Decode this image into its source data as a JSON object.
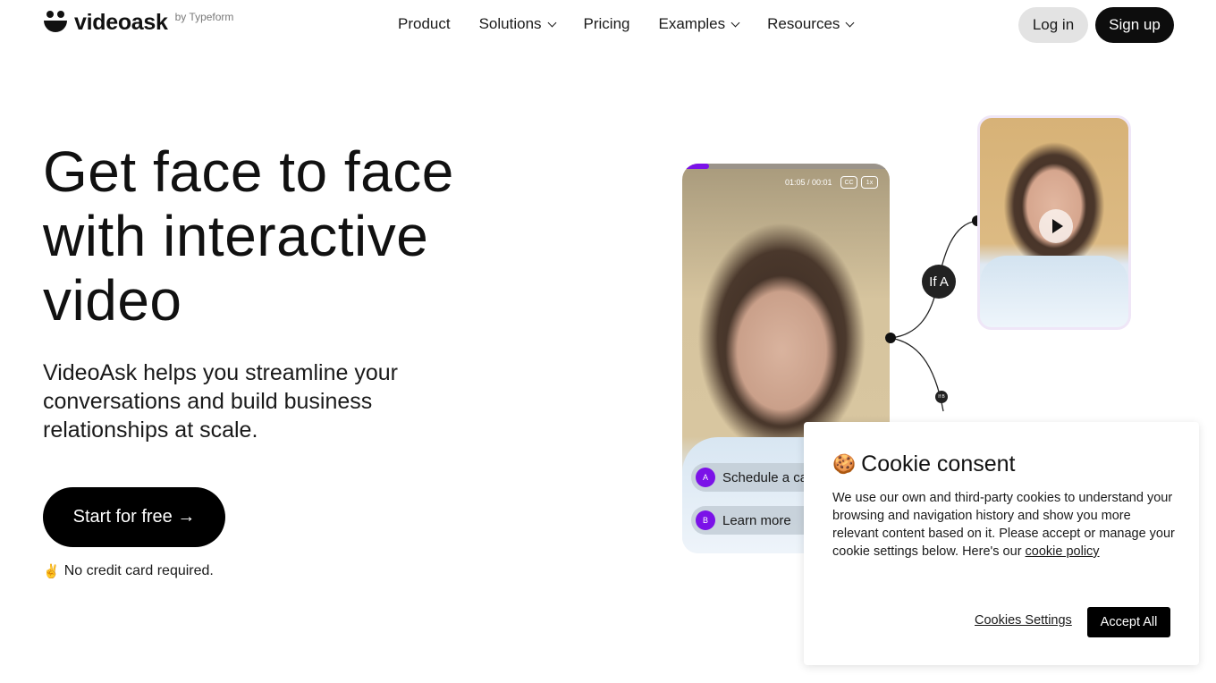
{
  "header": {
    "logo_word": "videoask",
    "logo_by": "by Typeform",
    "nav": [
      {
        "label": "Product",
        "has_dropdown": false
      },
      {
        "label": "Solutions",
        "has_dropdown": true
      },
      {
        "label": "Pricing",
        "has_dropdown": false
      },
      {
        "label": "Examples",
        "has_dropdown": true
      },
      {
        "label": "Resources",
        "has_dropdown": true
      }
    ],
    "login_label": "Log in",
    "signup_label": "Sign up"
  },
  "hero": {
    "title": "Get face to face with interactive video",
    "subtitle": "VideoAsk helps you streamline your conversations and build business relationships at scale.",
    "cta_label": "Start for free →",
    "note_emoji": "✌️",
    "note": "No credit card required."
  },
  "video_mockup": {
    "time": "01:05 / 00:01",
    "cc_label": "CC",
    "speed_label": "1x",
    "progress_fraction": 0.13,
    "accent_color": "#7b12e8",
    "choices": [
      {
        "badge": "A",
        "label": "Schedule a call"
      },
      {
        "badge": "B",
        "label": "Learn more"
      }
    ],
    "branch_a_label": "If A",
    "branch_b_label": "If B"
  },
  "cookie": {
    "emoji": "🍪",
    "title": "Cookie consent",
    "text": "We use our own and third-party cookies to understand your browsing and navigation history and show you more relevant content based on it. Please accept or manage your cookie settings below. Here's our ",
    "policy_link": "cookie policy",
    "settings_label": "Cookies Settings",
    "accept_label": "Accept All"
  }
}
